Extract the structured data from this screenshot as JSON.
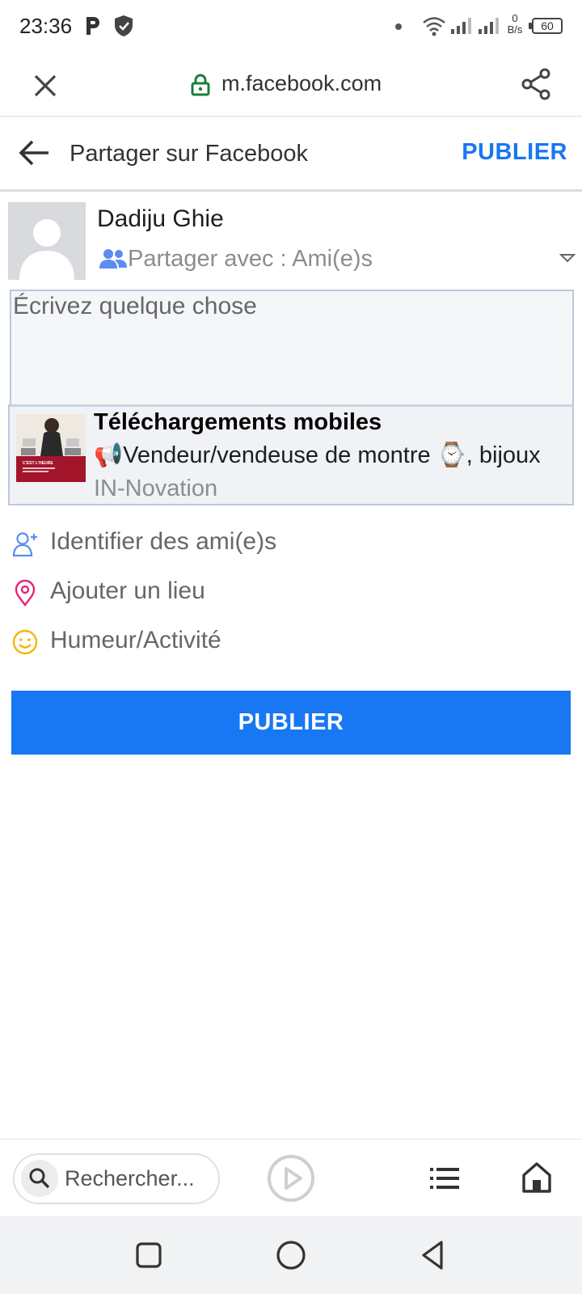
{
  "status_bar": {
    "time": "23:36",
    "net_speed_value": "0",
    "net_speed_unit": "B/s",
    "battery": "60",
    "icons": [
      "p-icon",
      "shield-icon",
      "dot-icon",
      "wifi-icon",
      "signal-icon",
      "signal-icon",
      "battery-icon"
    ]
  },
  "browser": {
    "url": "m.facebook.com",
    "icons": [
      "close-icon",
      "lock-icon",
      "share-icon"
    ]
  },
  "header": {
    "title": "Partager sur Facebook",
    "publish_label": "PUBLIER"
  },
  "composer": {
    "user_name": "Dadiju Ghie",
    "audience_label": "Partager avec :  Ami(e)s",
    "placeholder": "Écrivez quelque chose"
  },
  "share_card": {
    "title": "Téléchargements mobiles",
    "description": "📢Vendeur/vendeuse de montre ⌚, bijoux",
    "source": "IN-Novation",
    "thumbnail_text": "C'EST L'HEURE"
  },
  "actions": [
    {
      "label": "Identifier des ami(e)s",
      "icon": "add-friend-icon"
    },
    {
      "label": "Ajouter un lieu",
      "icon": "location-pin-icon"
    },
    {
      "label": "Humeur/Activité",
      "icon": "smiley-icon"
    }
  ],
  "publish_button": "PUBLIER",
  "bottom_bar": {
    "search_placeholder": "Rechercher..."
  },
  "colors": {
    "accent": "#1877f2",
    "pin": "#e4257a",
    "smiley": "#f2b705",
    "friend": "#5b8def"
  }
}
